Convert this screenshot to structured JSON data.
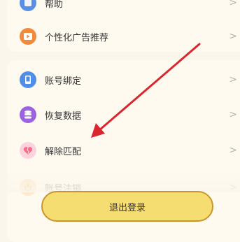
{
  "menu": {
    "items": [
      {
        "label": "帮助",
        "icon": "help-icon",
        "color": "#5a8fe6"
      },
      {
        "label": "个性化广告推荐",
        "icon": "ad-icon",
        "color": "#f08a3c"
      },
      {
        "label": "账号绑定",
        "icon": "phone-icon",
        "color": "#4f8de6"
      },
      {
        "label": "恢复数据",
        "icon": "database-icon",
        "color": "#9b63e0"
      },
      {
        "label": "解除匹配",
        "icon": "broken-heart-icon",
        "color": "#f06e8c"
      },
      {
        "label": "账号注销",
        "icon": "power-icon",
        "color": "#f2a23c"
      }
    ]
  },
  "logout_button": {
    "label": "退出登录"
  },
  "colors": {
    "annotation_arrow": "#d9262f",
    "button_fill": "#f6dd72",
    "button_border": "#c99530"
  }
}
